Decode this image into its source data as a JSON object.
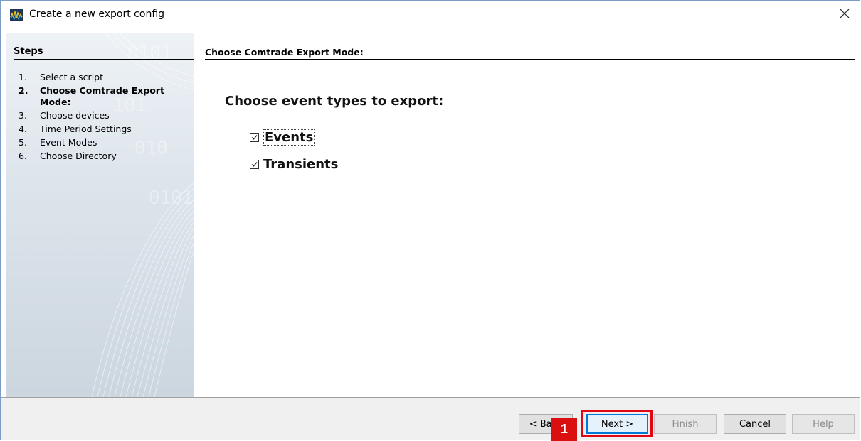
{
  "window": {
    "title": "Create a new export config",
    "close_symbol": "✕",
    "icon": "app-logo-icon"
  },
  "sidebar": {
    "heading": "Steps",
    "steps": [
      {
        "num": "1.",
        "label": "Select a script",
        "active": false
      },
      {
        "num": "2.",
        "label": "Choose Comtrade Export Mode:",
        "active": true
      },
      {
        "num": "3.",
        "label": "Choose devices",
        "active": false
      },
      {
        "num": "4.",
        "label": "Time Period Settings",
        "active": false
      },
      {
        "num": "5.",
        "label": "Event Modes",
        "active": false
      },
      {
        "num": "6.",
        "label": "Choose Directory",
        "active": false
      }
    ]
  },
  "content": {
    "heading": "Choose Comtrade Export Mode:",
    "prompt": "Choose event types to export:",
    "options": [
      {
        "label": "Events",
        "checked": true
      },
      {
        "label": "Transients",
        "checked": true
      }
    ]
  },
  "footer": {
    "back_label": "< Back",
    "next_label": "Next >",
    "finish_label": "Finish",
    "cancel_label": "Cancel",
    "help_label": "Help"
  },
  "annotation": {
    "badge_number": "1",
    "highlight_color": "#e30613"
  }
}
